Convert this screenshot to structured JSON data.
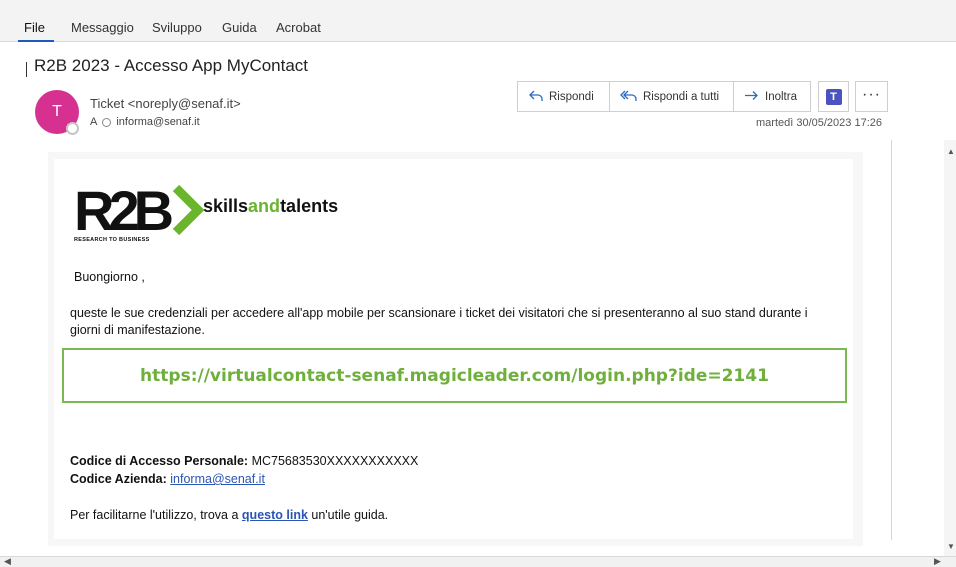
{
  "menu": [
    "File",
    "Messaggio",
    "Sviluppo",
    "Guida",
    "Acrobat"
  ],
  "subject": "R2B 2023 - Accesso App MyContact",
  "sender": {
    "initial": "T",
    "from": "Ticket <noreply@senaf.it>",
    "to_label": "A",
    "to": "informa@senaf.it",
    "date": "martedì 30/05/2023 17:26",
    "avatar_color": "#d63191"
  },
  "actions": {
    "reply": "Rispondi",
    "reply_all": "Rispondi a tutti",
    "forward": "Inoltra",
    "more": "···"
  },
  "icons": {
    "reply": "reply-icon",
    "reply_all": "reply-all-icon",
    "forward": "forward-icon",
    "teams": "teams-icon",
    "more": "more-icon"
  },
  "email": {
    "logo_brand": "skillsandtalents",
    "logo_brand_part1": "skills",
    "logo_brand_part2": "and",
    "logo_brand_part3": "talents",
    "logo_mark": "R2B",
    "logo_sub": "RESEARCH TO BUSINESS",
    "greeting": "Buongiorno ,",
    "paragraph": "queste le sue credenziali per accedere all'app mobile per scansionare i ticket dei visitatori che si presenteranno al suo stand durante i giorni di manifestazione.",
    "link": "https://virtualcontact-senaf.magicleader.com/login.php?ide=2141",
    "code_label": "Codice di Accesso Personale:",
    "code_value": "MC75683530XXXXXXXXXXX",
    "company_label": "Codice Azienda:",
    "company_value": "informa@senaf.it",
    "guide_prefix": "Per facilitarne l'utilizzo, trova a",
    "guide_link": "questo link",
    "guide_suffix": "un'utile guida.",
    "link_color": "#6fb03c",
    "accent_green": "#6ab42e"
  }
}
